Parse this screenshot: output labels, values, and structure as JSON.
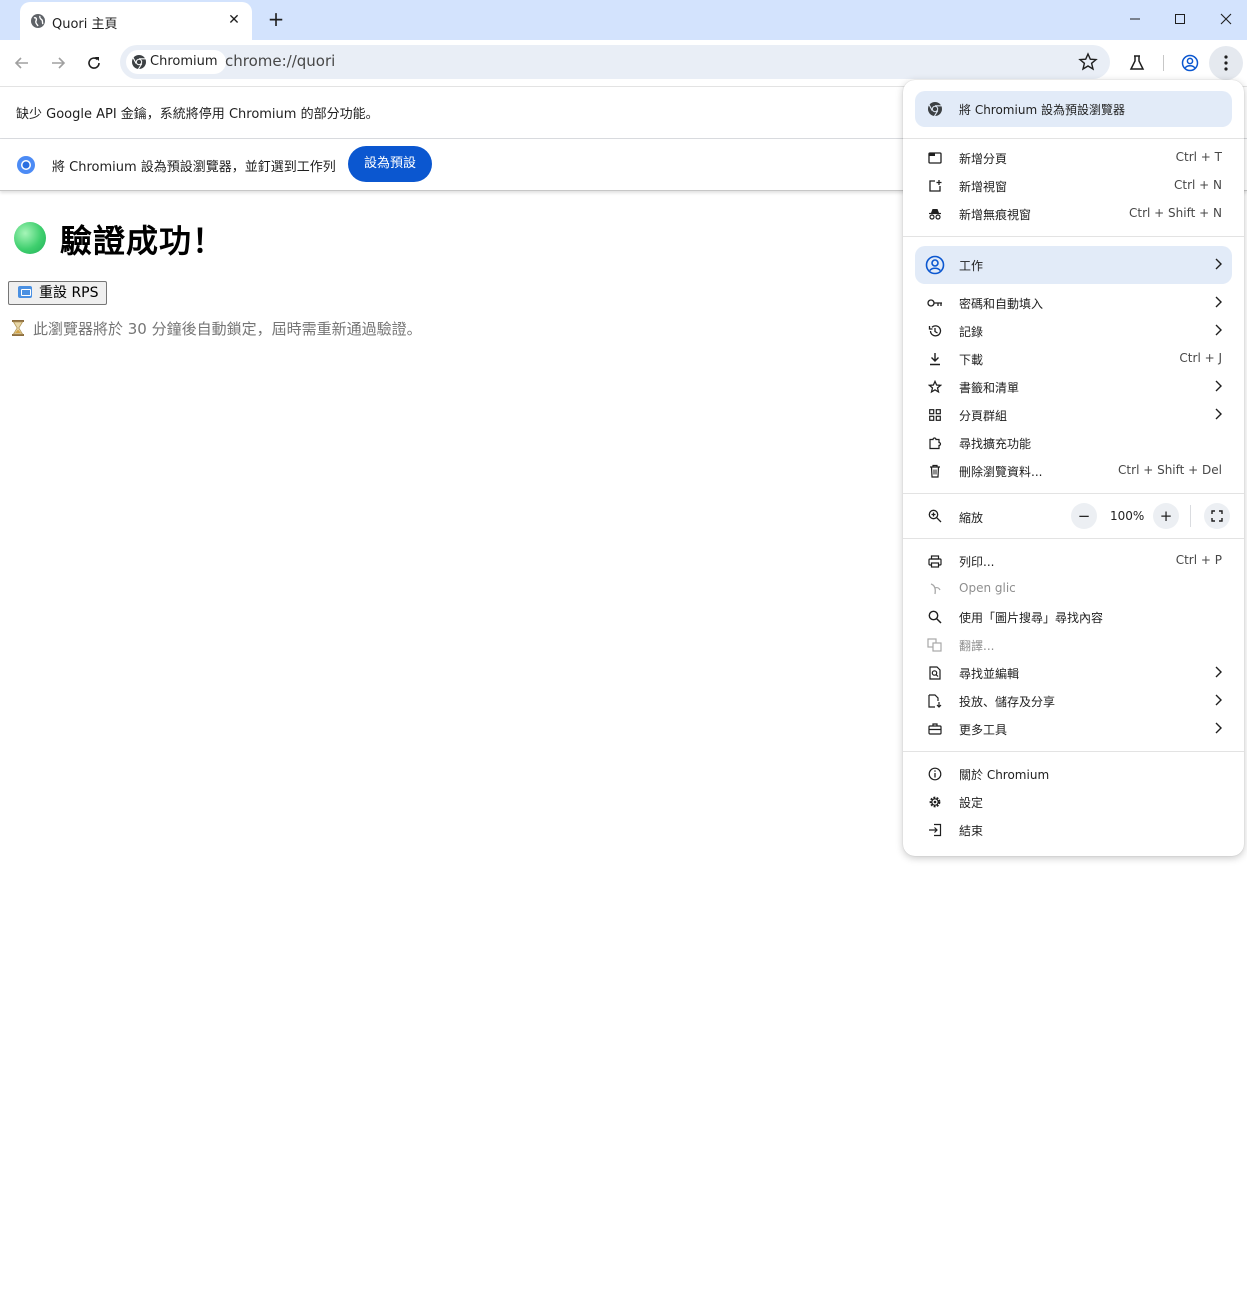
{
  "tab": {
    "title": "Quori 主頁",
    "close": "✕",
    "new_tab": "+"
  },
  "toolbar": {
    "chip_label": "Chromium",
    "url": "chrome://quori"
  },
  "infobar": {
    "api_key_message": "缺少 Google API 金鑰，系統將停用 Chromium 的部分功能。",
    "default_message": "將 Chromium 設為預設瀏覽器，並釘選到工作列",
    "default_button": "設為預設"
  },
  "page": {
    "heading": "驗證成功！",
    "reset_button": "重設 RPS",
    "lock_note": "此瀏覽器將於 30 分鐘後自動鎖定，屆時需重新通過驗證。"
  },
  "menu": {
    "set_default": "將 Chromium 設為預設瀏覽器",
    "group1": [
      {
        "label": "新增分頁",
        "shortcut": "Ctrl + T",
        "icon": "new-tab-icon"
      },
      {
        "label": "新增視窗",
        "shortcut": "Ctrl + N",
        "icon": "new-window-icon"
      },
      {
        "label": "新增無痕視窗",
        "shortcut": "Ctrl + Shift + N",
        "icon": "incognito-icon"
      }
    ],
    "profile": "工作",
    "group2": [
      {
        "label": "密碼和自動填入",
        "shortcut": "",
        "icon": "key-icon"
      },
      {
        "label": "記錄",
        "shortcut": "",
        "icon": "history-icon"
      },
      {
        "label": "下載",
        "shortcut": "Ctrl + J",
        "icon": "download-icon"
      },
      {
        "label": "書籤和清單",
        "shortcut": "",
        "icon": "star-icon"
      },
      {
        "label": "分頁群組",
        "shortcut": "",
        "icon": "grid-icon"
      },
      {
        "label": "尋找擴充功能",
        "shortcut": "",
        "icon": "puzzle-icon"
      },
      {
        "label": "刪除瀏覽資料...",
        "shortcut": "Ctrl + Shift + Del",
        "icon": "trash-icon"
      }
    ],
    "zoom": {
      "label": "縮放",
      "value": "100%",
      "minus": "−",
      "plus": "+"
    },
    "group3": [
      {
        "label": "列印...",
        "shortcut": "Ctrl + P",
        "icon": "print-icon"
      },
      {
        "label": "Open glic",
        "shortcut": "",
        "icon": "glic-icon"
      },
      {
        "label": "使用「圖片搜尋」尋找內容",
        "shortcut": "",
        "icon": "search-icon"
      },
      {
        "label": "翻譯...",
        "shortcut": "",
        "icon": "translate-icon"
      },
      {
        "label": "尋找並編輯",
        "shortcut": "",
        "icon": "find-edit-icon"
      },
      {
        "label": "投放、儲存及分享",
        "shortcut": "",
        "icon": "cast-save-icon"
      },
      {
        "label": "更多工具",
        "shortcut": "",
        "icon": "toolbox-icon"
      }
    ],
    "group4": [
      {
        "label": "關於 Chromium",
        "icon": "info-icon"
      },
      {
        "label": "設定",
        "icon": "gear-icon"
      },
      {
        "label": "結束",
        "icon": "exit-icon"
      }
    ]
  },
  "colors": {
    "accent": "#0b57d0",
    "titlebar": "#d3e3fd",
    "menu_highlight": "#e2ebf8"
  }
}
